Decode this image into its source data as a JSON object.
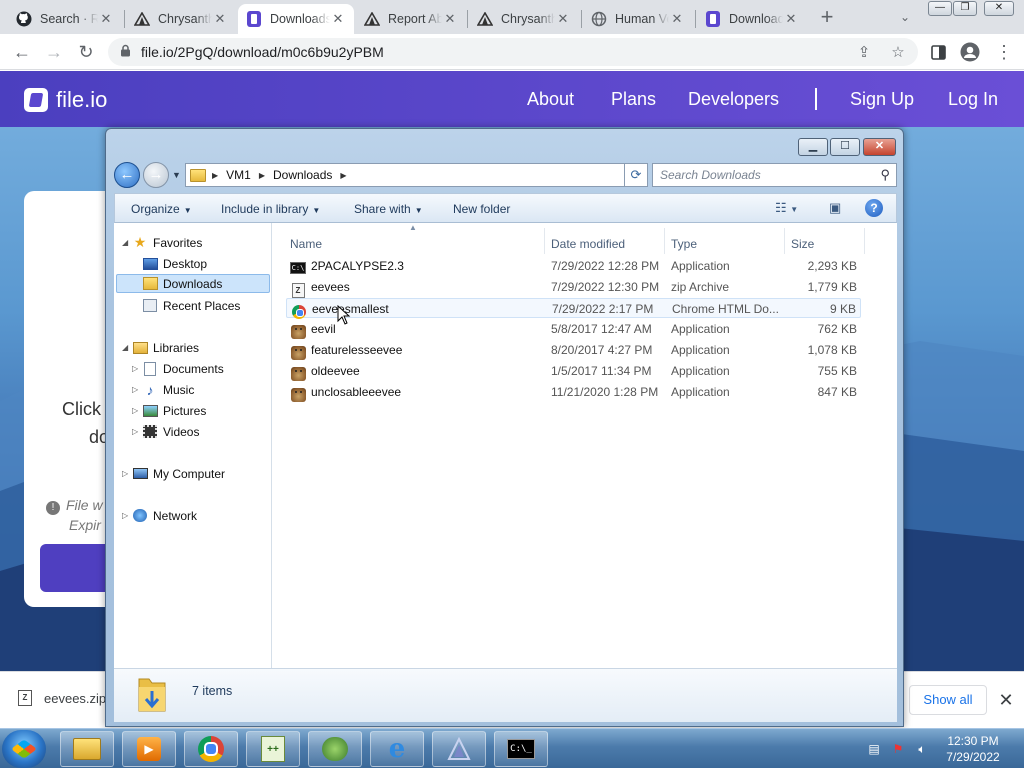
{
  "browser": {
    "tabs": [
      {
        "label": "Search · R",
        "icon": "github-icon"
      },
      {
        "label": "Chrysanthemum",
        "icon": "tent-icon"
      },
      {
        "label": "Downloads",
        "icon": "file-io-icon",
        "active": true
      },
      {
        "label": "Report Abuse",
        "icon": "tent-icon"
      },
      {
        "label": "Chrysanthemum",
        "icon": "tent-icon"
      },
      {
        "label": "Human Verification",
        "icon": "globe-icon"
      },
      {
        "label": "Downloads",
        "icon": "file-io-icon"
      }
    ],
    "url": "file.io/2PgQ/download/m0c6b9u2yPBM",
    "accent": "#1a73e8"
  },
  "site": {
    "logo": "file.io",
    "nav": [
      "About",
      "Plans",
      "Developers",
      "Sign Up",
      "Log In"
    ],
    "card_line1": "Click",
    "card_line2": "do",
    "card_note1": "File w",
    "card_note2": "Expir"
  },
  "download_bar": {
    "item": "eevees.zip",
    "show_all": "Show all"
  },
  "explorer": {
    "breadcrumb": [
      "VM1",
      "Downloads"
    ],
    "search_placeholder": "Search Downloads",
    "commands": [
      "Organize",
      "Include in library",
      "Share with",
      "New folder"
    ],
    "nav": {
      "favorites": "Favorites",
      "favorites_items": [
        "Desktop",
        "Downloads",
        "Recent Places"
      ],
      "libraries": "Libraries",
      "libraries_items": [
        "Documents",
        "Music",
        "Pictures",
        "Videos"
      ],
      "computer": "My Computer",
      "network": "Network"
    },
    "columns": [
      "Name",
      "Date modified",
      "Type",
      "Size"
    ],
    "files": [
      {
        "name": "2PACALYPSE2.3",
        "date": "7/29/2022 12:28 PM",
        "type": "Application",
        "size": "2,293 KB",
        "icon": "console-app-icon"
      },
      {
        "name": "eevees",
        "date": "7/29/2022 12:30 PM",
        "type": "zip Archive",
        "size": "1,779 KB",
        "icon": "zip-icon"
      },
      {
        "name": "eeveesmallest",
        "date": "7/29/2022 2:17 PM",
        "type": "Chrome HTML Do...",
        "size": "9 KB",
        "icon": "chrome-html-icon"
      },
      {
        "name": "eevil",
        "date": "5/8/2017 12:47 AM",
        "type": "Application",
        "size": "762 KB",
        "icon": "eevee-app-icon"
      },
      {
        "name": "featurelesseevee",
        "date": "8/20/2017 4:27 PM",
        "type": "Application",
        "size": "1,078 KB",
        "icon": "eevee-app-icon"
      },
      {
        "name": "oldeevee",
        "date": "1/5/2017 11:34 PM",
        "type": "Application",
        "size": "755 KB",
        "icon": "eevee-app-icon"
      },
      {
        "name": "unclosableeevee",
        "date": "11/21/2020 1:28 PM",
        "type": "Application",
        "size": "847 KB",
        "icon": "eevee-app-icon"
      }
    ],
    "status": "7 items"
  },
  "taskbar": {
    "time": "12:30 PM",
    "date": "7/29/2022"
  }
}
